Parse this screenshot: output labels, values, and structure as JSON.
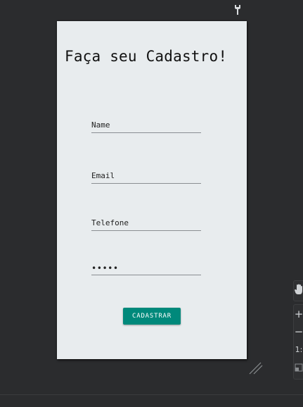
{
  "app": {
    "title": "Faça seu Cadastro!"
  },
  "form": {
    "name_value": "Name",
    "email_value": "Email",
    "phone_value": "Telefone",
    "password_value": "•••••",
    "submit_label": "CADASTRAR"
  },
  "toolbar": {
    "zoom_in_label": "+",
    "zoom_out_label": "−",
    "actual_size_label": "1:"
  },
  "colors": {
    "canvas_background": "#2b2c2e",
    "screen_background": "#e8ecee",
    "accent": "#00897b"
  },
  "icons": {
    "top": "wrench-icon",
    "resize": "resize-handle-icon",
    "pan": "hand-icon",
    "fit": "fit-screen-icon"
  }
}
